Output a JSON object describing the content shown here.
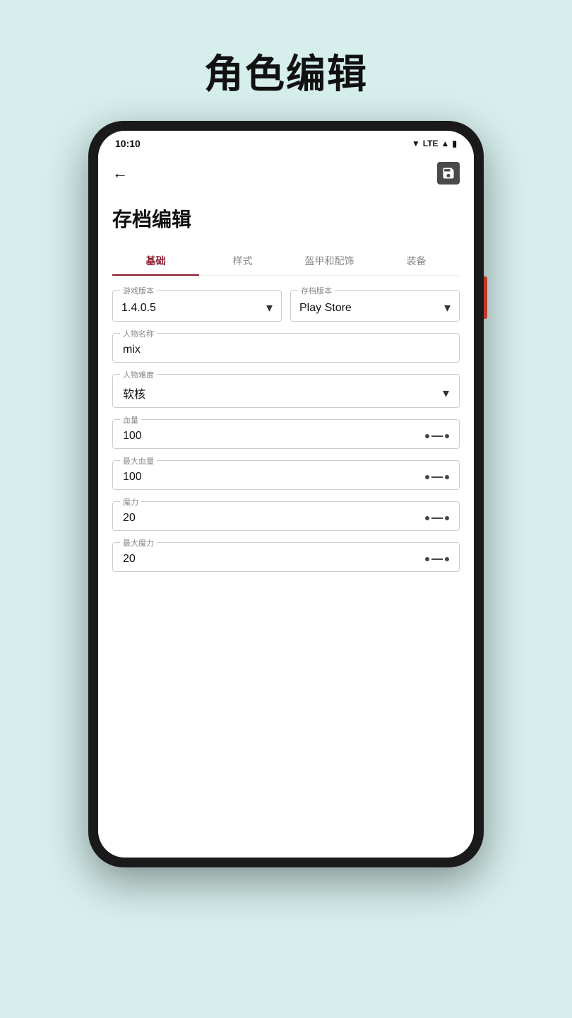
{
  "page": {
    "title": "角色编辑",
    "background": "#d6eeec"
  },
  "status_bar": {
    "time": "10:10",
    "signal": "▼",
    "network": "LTE",
    "signal_bars": "▲",
    "battery": "🔋"
  },
  "app_bar": {
    "back_label": "←",
    "save_label": "💾"
  },
  "archive_title": "存档编辑",
  "tabs": [
    {
      "label": "基础",
      "active": true
    },
    {
      "label": "样式",
      "active": false
    },
    {
      "label": "盔甲和配饰",
      "active": false
    },
    {
      "label": "装备",
      "active": false
    }
  ],
  "form": {
    "game_version_label": "游戏版本",
    "game_version_value": "1.4.0.5",
    "save_version_label": "存档版本",
    "save_version_value": "Play Store",
    "character_name_label": "人物名称",
    "character_name_value": "mix",
    "character_difficulty_label": "人物难度",
    "character_difficulty_value": "软核",
    "hp_label": "血量",
    "hp_value": "100",
    "max_hp_label": "最大血量",
    "max_hp_value": "100",
    "mp_label": "魔力",
    "mp_value": "20",
    "max_mp_label": "最大魔力",
    "max_mp_value": "20"
  }
}
